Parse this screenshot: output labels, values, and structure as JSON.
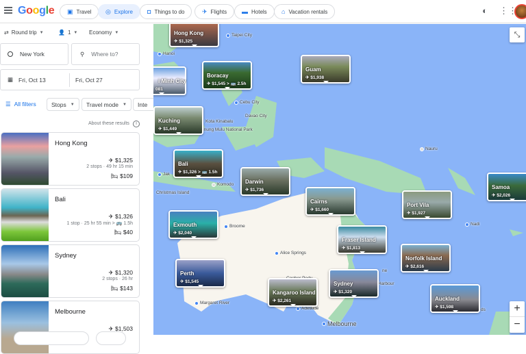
{
  "header": {
    "logo": "Google",
    "nav": [
      {
        "label": "Travel",
        "icon": "suitcase-icon"
      },
      {
        "label": "Explore",
        "icon": "explore-icon"
      },
      {
        "label": "Things to do",
        "icon": "camera-icon"
      },
      {
        "label": "Flights",
        "icon": "plane-icon"
      },
      {
        "label": "Hotels",
        "icon": "bed-icon"
      },
      {
        "label": "Vacation rentals",
        "icon": "house-icon"
      }
    ]
  },
  "search": {
    "trip_type": "Round trip",
    "passengers": "1",
    "cabin": "Economy",
    "origin": "New York",
    "destination_placeholder": "Where to?",
    "depart": "Fri, Oct 13",
    "return": "Fri, Oct 27"
  },
  "filters": {
    "all": "All filters",
    "stops": "Stops",
    "travel_mode": "Travel mode",
    "interests": "Inte"
  },
  "about": "About these results",
  "results": [
    {
      "name": "Hong Kong",
      "flight": "$1,325",
      "details": "2 stops · 49 hr 15 min",
      "hotel": "$109"
    },
    {
      "name": "Bali",
      "flight": "$1,326",
      "details": "1 stop · 25 hr 55 min > 🚌 1.5h",
      "hotel": "$40"
    },
    {
      "name": "Sydney",
      "flight": "$1,320",
      "details": "2 stops · 26 hr",
      "hotel": "$143"
    },
    {
      "name": "Melbourne",
      "flight": "$1,503",
      "details": "",
      "hotel": ""
    }
  ],
  "map": {
    "cards": [
      {
        "name": "Hong Kong",
        "price": "✈ $1,325"
      },
      {
        "name": "i Minh City",
        "price": "081"
      },
      {
        "name": "Boracay",
        "price": "✈ $1,545 > 🚌 2.5h"
      },
      {
        "name": "Guam",
        "price": "✈ $1,938"
      },
      {
        "name": "Kuching",
        "price": "✈ $1,449"
      },
      {
        "name": "Bali",
        "price": "✈ $1,326 > 🚌 1.5h"
      },
      {
        "name": "Darwin",
        "price": "✈ $1,736"
      },
      {
        "name": "Cairns",
        "price": "✈ $1,660"
      },
      {
        "name": "Exmouth",
        "price": "✈ $2,040"
      },
      {
        "name": "Fraser Island",
        "price": "✈ $1,813"
      },
      {
        "name": "Perth",
        "price": "✈ $1,545"
      },
      {
        "name": "Kangaroo Island",
        "price": "✈ $2,261"
      },
      {
        "name": "Sydney",
        "price": "✈ $1,320"
      },
      {
        "name": "Port Vila",
        "price": "✈ $1,927"
      },
      {
        "name": "Norfolk Island",
        "price": "✈ $2,616"
      },
      {
        "name": "Auckland",
        "price": "✈ $1,598"
      },
      {
        "name": "Samoa",
        "price": "✈ $2,026"
      }
    ],
    "places": [
      "Taipei City",
      "Hanoi",
      "Cebu City",
      "Davao City",
      "Kota Kinabalu",
      "unung Mulu National Park",
      "Jak",
      "Komodo",
      "Christmas Island",
      "Broome",
      "Alice Springs",
      "Coober Pedy",
      "Margaret River",
      "Adelaide",
      "Melbourne",
      "Nauru",
      "Nadi",
      "Harbour",
      "ne",
      "ds"
    ],
    "zoom_in": "+",
    "zoom_out": "−"
  }
}
